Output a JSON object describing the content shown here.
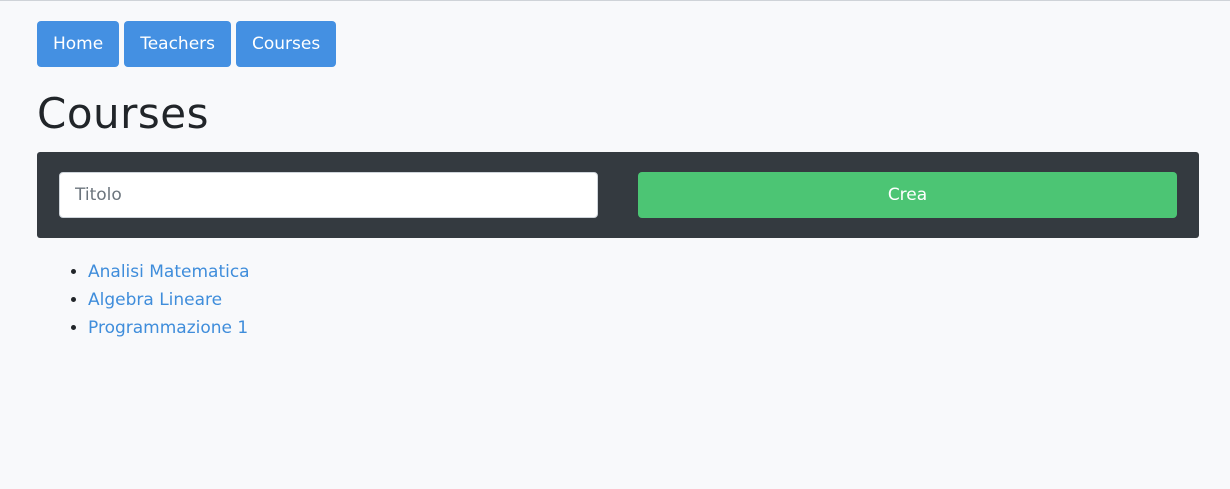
{
  "nav": {
    "items": [
      {
        "label": "Home"
      },
      {
        "label": "Teachers"
      },
      {
        "label": "Courses"
      }
    ]
  },
  "page": {
    "title": "Courses"
  },
  "form": {
    "title_placeholder": "Titolo",
    "title_value": "",
    "submit_label": "Crea"
  },
  "courses": [
    {
      "name": "Analisi Matematica"
    },
    {
      "name": "Algebra Lineare"
    },
    {
      "name": "Programmazione 1"
    }
  ],
  "colors": {
    "nav_button": "#4490e2",
    "create_button": "#4cc574",
    "form_bar": "#343a40",
    "link": "#3f8ddb",
    "background": "#f8f9fb"
  }
}
